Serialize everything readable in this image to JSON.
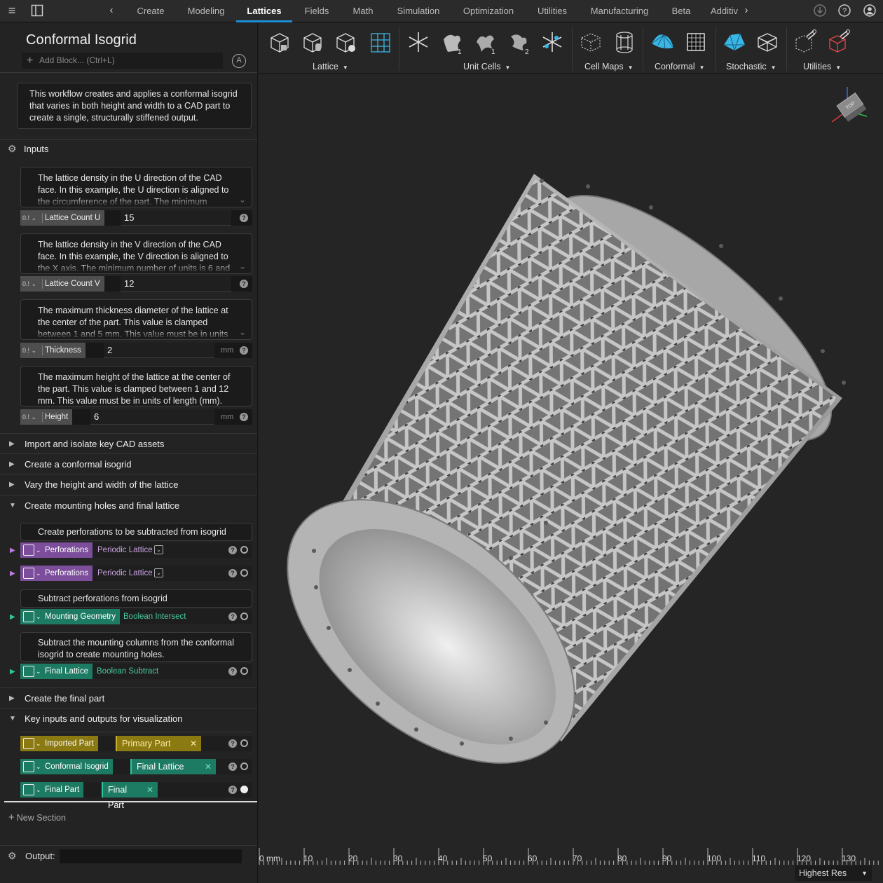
{
  "topbar": {
    "tabs": [
      {
        "label": "Create"
      },
      {
        "label": "Modeling"
      },
      {
        "label": "Lattices",
        "active": true
      },
      {
        "label": "Fields"
      },
      {
        "label": "Math"
      },
      {
        "label": "Simulation"
      },
      {
        "label": "Optimization"
      },
      {
        "label": "Utilities"
      },
      {
        "label": "Manufacturing"
      },
      {
        "label": "Beta"
      },
      {
        "label": "Additiv"
      }
    ],
    "icons": [
      "menu-icon",
      "panel-toggle-icon",
      "chevron-left-icon",
      "chevron-right-icon",
      "download-icon",
      "help-icon",
      "account-icon"
    ]
  },
  "workflow": {
    "title": "Conformal Isogrid",
    "add_block_placeholder": "Add Block... (Ctrl+L)",
    "description": "This workflow creates and applies a conformal isogrid that varies in both height and width to a CAD part to create a single, structurally stiffened output."
  },
  "inputs": {
    "label": "Inputs",
    "params": [
      {
        "desc": "The lattice density in the U direction of the CAD face. In this example, the U direction is aligned to the circumference of the part. The minimum",
        "type": "0.1",
        "name": "Lattice Count U",
        "value": "15",
        "unit": ""
      },
      {
        "desc": "The lattice density in the V direction of the CAD face. In this example, the V direction is aligned to the X axis. The minimum number of units is 6 and",
        "type": "0.1",
        "name": "Lattice Count V",
        "value": "12",
        "unit": ""
      },
      {
        "desc": "The maximum thickness diameter of the lattice at the center of the part. This value is clamped between 1 and 5 mm. This value must be in units of",
        "type": "0.1",
        "name": "Thickness",
        "value": "2",
        "unit": "mm"
      },
      {
        "desc": "The maximum height of the lattice at the center of the part. This value is clamped between 1 and 12 mm. This value must be in units of length (mm).",
        "type": "0.1",
        "name": "Height",
        "value": "6",
        "unit": "mm"
      }
    ]
  },
  "sections": {
    "import": "Import and isolate key CAD assets",
    "create": "Create a conformal isogrid",
    "vary": "Vary the height and width of the lattice",
    "mounting": "Create mounting holes and final lattice",
    "final": "Create the final part",
    "key": "Key inputs and outputs for visualization"
  },
  "mounting": {
    "desc1": "Create perforations to be subtracted from isogrid",
    "b1": {
      "name": "Perforations",
      "op": "Periodic Lattice"
    },
    "b2": {
      "name": "Perforations",
      "op": "Periodic Lattice"
    },
    "desc2": "Subtract perforations from isogrid",
    "b3": {
      "name": "Mounting Geometry",
      "op": "Boolean Intersect"
    },
    "desc3": "Subtract the mounting columns from the conformal isogrid to create mounting holes.",
    "b4": {
      "name": "Final Lattice",
      "op": "Boolean Subtract"
    }
  },
  "key_io": {
    "r1": {
      "name": "Imported Part",
      "chip": "Primary Part"
    },
    "r2": {
      "name": "Conformal Isogrid",
      "chip": "Final Lattice"
    },
    "r3": {
      "name": "Final Part",
      "chip": "Final Part"
    }
  },
  "new_section": "New Section",
  "output_label": "Output:",
  "toolbar": {
    "groups": [
      "Lattice",
      "Unit Cells",
      "Cell Maps",
      "Conformal",
      "Stochastic",
      "Utilities"
    ]
  },
  "viewport": {
    "ruler_labels": [
      "0 mm",
      "10",
      "20",
      "30",
      "40",
      "50",
      "60",
      "70",
      "80",
      "90",
      "100",
      "110",
      "120",
      "130"
    ],
    "resolution": "Highest Res",
    "navcube_label": "TOP"
  },
  "colors": {
    "accent": "#1e8fd6",
    "purple_block": "#7b4d9a",
    "green_block": "#1d7a63",
    "olive_block": "#8b7a12"
  }
}
